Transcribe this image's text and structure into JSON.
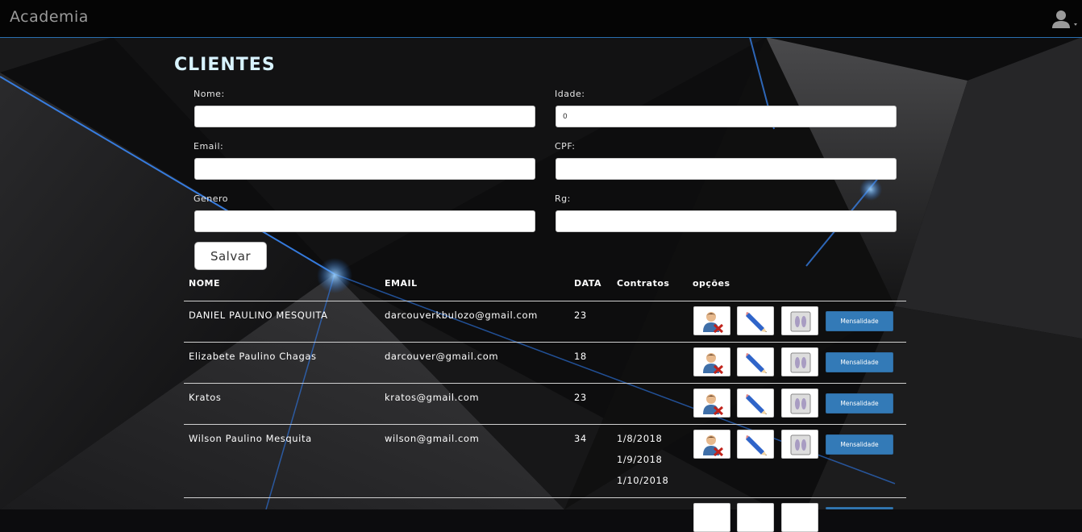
{
  "navbar": {
    "brand": "Academia"
  },
  "page": {
    "title": "CLIENTES"
  },
  "form": {
    "nome": {
      "label": "Nome:",
      "value": ""
    },
    "idade": {
      "label": "Idade:",
      "value": "0"
    },
    "email": {
      "label": "Email:",
      "value": ""
    },
    "cpf": {
      "label": "CPF:",
      "value": ""
    },
    "genero": {
      "label": "Genero",
      "value": ""
    },
    "rg": {
      "label": "Rg:",
      "value": ""
    },
    "save_label": "Salvar"
  },
  "table": {
    "headers": {
      "nome": "NOME",
      "email": "EMAIL",
      "data": "DATA",
      "contratos": "Contratos",
      "opcoes": "opções"
    },
    "mensalidade_label": "Mensalidade",
    "rows": [
      {
        "nome": "DANIEL PAULINO MESQUITA",
        "email": "darcouverkbulozo@gmail.com",
        "data": "23",
        "contratos": []
      },
      {
        "nome": "Elizabete Paulino Chagas",
        "email": "darcouver@gmail.com",
        "data": "18",
        "contratos": []
      },
      {
        "nome": "Kratos",
        "email": "kratos@gmail.com",
        "data": "23",
        "contratos": []
      },
      {
        "nome": "Wilson Paulino Mesquita",
        "email": "wilson@gmail.com",
        "data": "34",
        "contratos": [
          "1/8/2018",
          "1/9/2018",
          "1/10/2018"
        ]
      }
    ]
  },
  "icons": {
    "user": "user-icon",
    "delete": "delete-user-icon",
    "edit": "pencil-icon",
    "measure": "footprints-scale-icon"
  },
  "colors": {
    "navbar_border": "#2a6fb0",
    "title": "#d8f3ff",
    "mensalidade_btn": "#337ab7"
  }
}
